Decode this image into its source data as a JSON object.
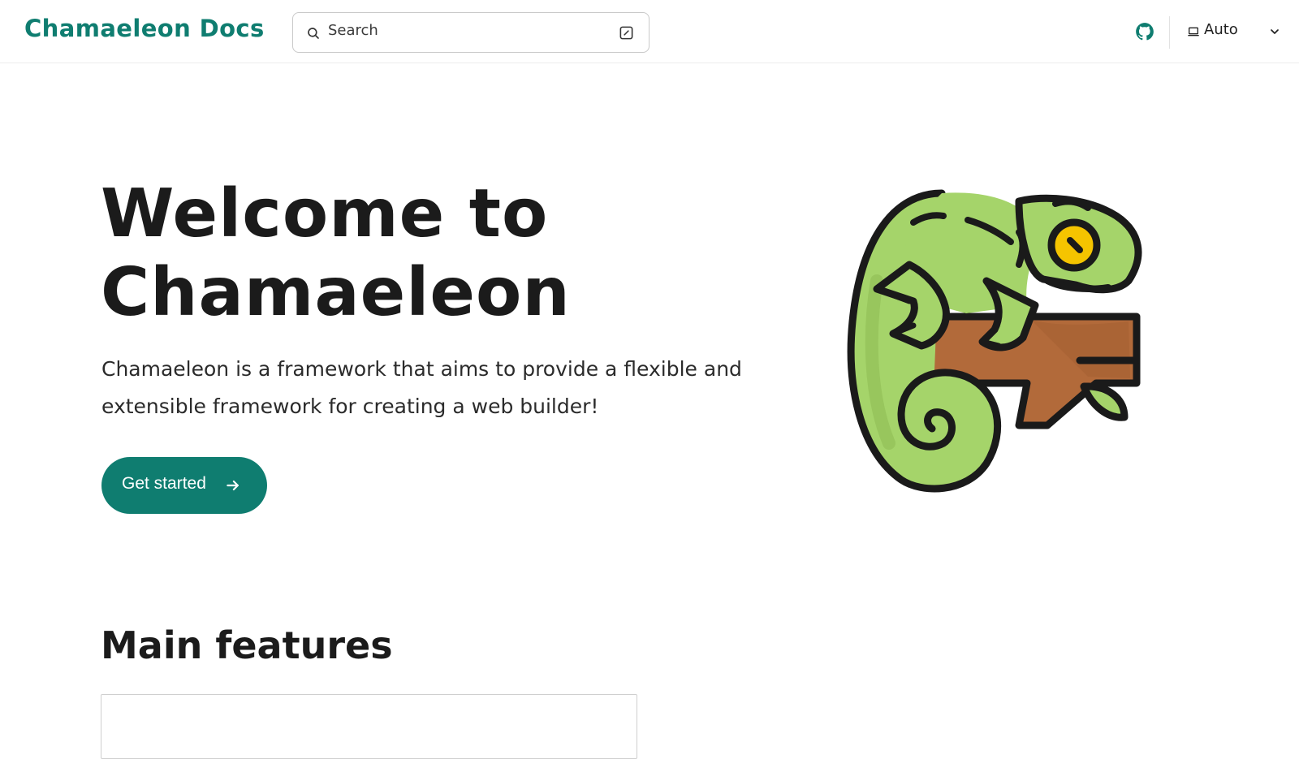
{
  "header": {
    "brand": "Chamaeleon Docs",
    "search_placeholder": "Search",
    "theme_label": "Auto"
  },
  "hero": {
    "title_line1": "Welcome to",
    "title_line2": "Chamaeleon",
    "description_line1": "Chamaeleon is a framework that aims to provide a flexible and",
    "description_line2": "extensible framework for creating a web builder!",
    "cta_label": "Get started"
  },
  "features": {
    "heading": "Main features"
  },
  "icons": {
    "search": "search-icon",
    "shortcut": "keyboard-shortcut-icon",
    "github": "github-icon",
    "theme": "laptop-icon",
    "dropdown": "chevron-down-icon",
    "cta": "arrow-right-icon",
    "mascot": "chameleon-illustration"
  },
  "colors": {
    "accent": "#0f7d70",
    "text": "#1b1b1b",
    "chameleon_green": "#a5d46a",
    "branch_brown": "#b26a3a",
    "eye_yellow": "#f5c400"
  }
}
